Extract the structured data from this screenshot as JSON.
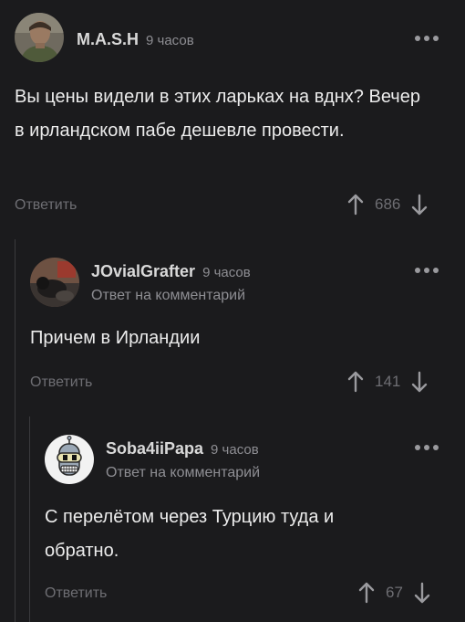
{
  "comments": [
    {
      "author": "M.A.S.H",
      "time": "9 часов",
      "text": "Вы цены видели в этих ларьках на вднх? Вечер в ирландском пабе дешевле провести.",
      "reply_label": "Ответить",
      "votes": "686",
      "avatar_icon": "soldier-portrait-avatar"
    },
    {
      "author": "JOvialGrafter",
      "time": "9 часов",
      "subtitle": "Ответ на комментарий",
      "text": "Причем в Ирландии",
      "reply_label": "Ответить",
      "votes": "141",
      "avatar_icon": "cats-photo-avatar"
    },
    {
      "author": "Soba4iiPapa",
      "time": "9 часов",
      "subtitle": "Ответ на комментарий",
      "text": "С перелётом через Турцию туда и обратно.",
      "reply_label": "Ответить",
      "votes": "67",
      "avatar_icon": "bender-robot-avatar"
    }
  ],
  "colors": {
    "background": "#1b1b1d",
    "text": "#ececec",
    "muted": "#8e8e93",
    "thread_line": "#3a3a3d"
  },
  "icons": [
    "more-dots-icon",
    "arrow-up-icon",
    "arrow-down-icon"
  ]
}
